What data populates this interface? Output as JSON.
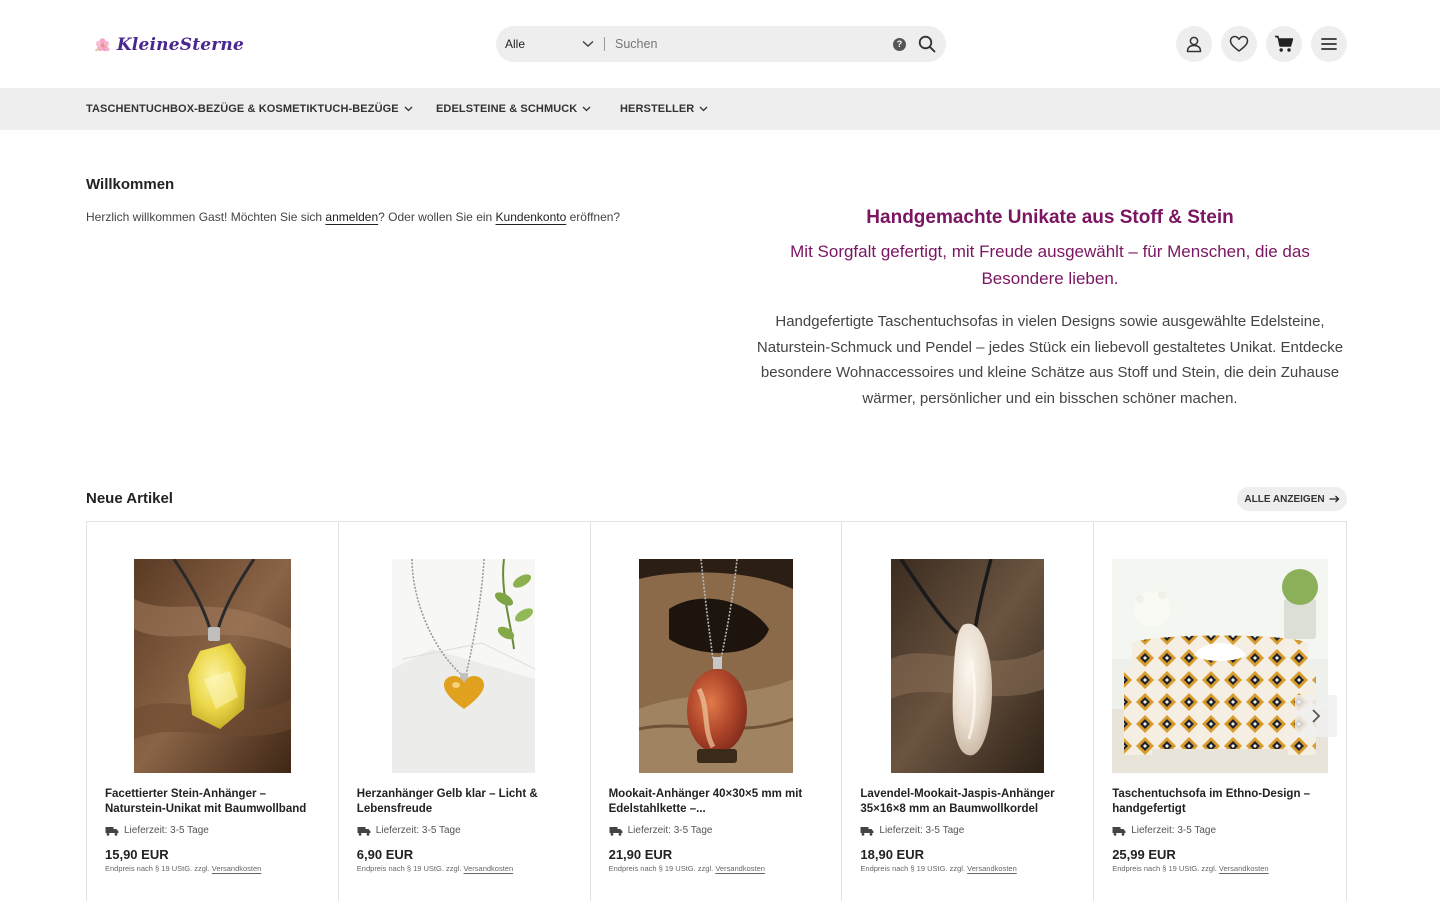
{
  "header": {
    "logo_text": "KleineSterne",
    "search": {
      "category": "Alle",
      "placeholder": "Suchen",
      "help": "?"
    }
  },
  "nav": {
    "items": [
      {
        "label": "TASCHENTUCHBOX-BEZÜGE & KOSMETIKTUCH-BEZÜGE"
      },
      {
        "label": "EDELSTEINE & SCHMUCK"
      },
      {
        "label": "HERSTELLER"
      }
    ]
  },
  "welcome": {
    "title": "Willkommen",
    "text_before": "Herzlich willkommen Gast! Möchten Sie sich ",
    "login_link": "anmelden",
    "text_middle": "? Oder wollen Sie ein ",
    "account_link": "Kundenkonto",
    "text_after": " eröffnen?"
  },
  "promo": {
    "title": "Handgemachte Unikate aus Stoff & Stein",
    "subtitle": "Mit Sorgfalt gefertigt, mit Freude ausgewählt – für Menschen, die das Besondere lieben.",
    "body": "Handgefertigte Taschentuchsofas in vielen Designs sowie ausgewählte Edelsteine, Naturstein-Schmuck und Pendel – jedes Stück ein liebevoll gestaltetes Unikat. Entdecke besondere Wohnaccessoires und kleine Schätze aus Stoff und Stein, die dein Zuhause wärmer, persönlicher und ein bisschen schöner machen."
  },
  "new_articles": {
    "title": "Neue Artikel",
    "show_all": "ALLE ANZEIGEN",
    "products": [
      {
        "title": "Facettierter Stein-Anhänger – Naturstein-Unikat mit Baumwollband",
        "delivery": "Lieferzeit: 3-5 Tage",
        "price": "15,90 EUR",
        "tax_text": "Endpreis nach § 19 UStG. zzgl. ",
        "shipping_link": "Versandkosten"
      },
      {
        "title": "Herzanhänger Gelb klar – Licht & Lebensfreude",
        "delivery": "Lieferzeit: 3-5 Tage",
        "price": "6,90 EUR",
        "tax_text": "Endpreis nach § 19 UStG. zzgl. ",
        "shipping_link": "Versandkosten"
      },
      {
        "title": "Mookait-Anhänger 40×30×5 mm mit Edelstahlkette –...",
        "delivery": "Lieferzeit: 3-5 Tage",
        "price": "21,90 EUR",
        "tax_text": "Endpreis nach § 19 UStG. zzgl. ",
        "shipping_link": "Versandkosten"
      },
      {
        "title": "Lavendel-Mookait-Jaspis-Anhänger 35×16×8 mm an Baumwollkordel",
        "delivery": "Lieferzeit: 3-5 Tage",
        "price": "18,90 EUR",
        "tax_text": "Endpreis nach § 19 UStG. zzgl. ",
        "shipping_link": "Versandkosten"
      },
      {
        "title": "Taschentuchsofa im Ethno-Design – handgefertigt",
        "delivery": "Lieferzeit: 3-5 Tage",
        "price": "25,99 EUR",
        "tax_text": "Endpreis nach § 19 UStG. zzgl. ",
        "shipping_link": "Versandkosten"
      }
    ]
  },
  "colors": {
    "accent": "#7b1561",
    "logo": "#4a2790",
    "panel": "#eeeeee"
  }
}
